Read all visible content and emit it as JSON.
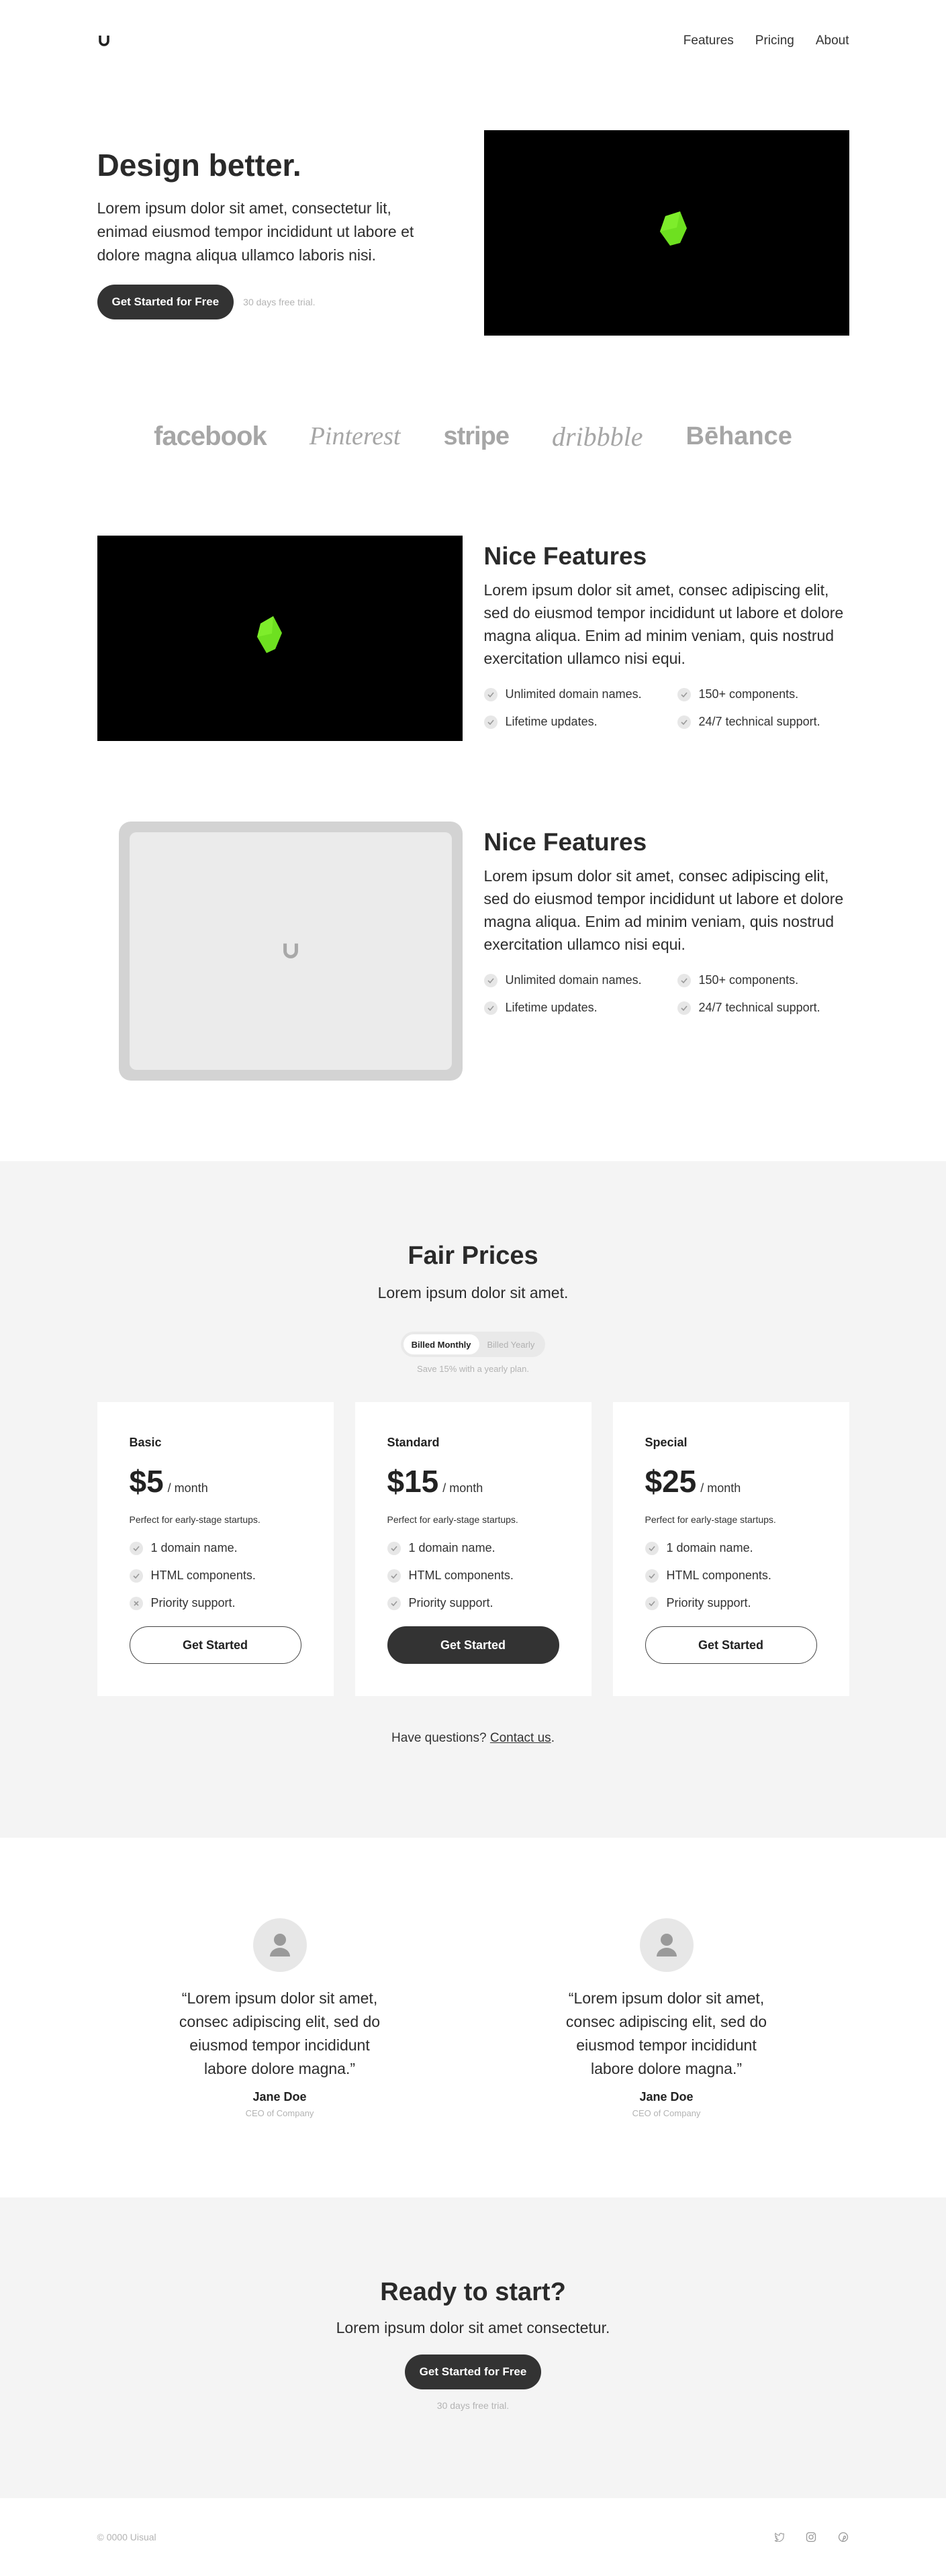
{
  "nav": {
    "links": [
      "Features",
      "Pricing",
      "About"
    ]
  },
  "hero": {
    "title": "Design better.",
    "text": "Lorem ipsum dolor sit amet, consectetur lit, enimad eiusmod tempor incididunt ut labore et dolore magna aliqua ullamco laboris nisi.",
    "cta": "Get Started for Free",
    "note": "30 days free trial."
  },
  "logos": [
    "facebook",
    "Pinterest",
    "stripe",
    "dribbble",
    "Bēhance"
  ],
  "features": [
    {
      "title": "Nice Features",
      "text": "Lorem ipsum dolor sit amet, consec adipiscing elit, sed do eiusmod tempor incididunt ut labore et dolore magna aliqua. Enim ad minim veniam, quis nostrud exercitation ullamco nisi equi.",
      "items": [
        "Unlimited domain names.",
        "150+ components.",
        "Lifetime updates.",
        "24/7 technical support."
      ]
    },
    {
      "title": "Nice Features",
      "text": "Lorem ipsum dolor sit amet, consec adipiscing elit, sed do eiusmod tempor incididunt ut labore et dolore magna aliqua. Enim ad minim veniam, quis nostrud exercitation ullamco nisi equi.",
      "items": [
        "Unlimited domain names.",
        "150+ components.",
        "Lifetime updates.",
        "24/7 technical support."
      ]
    }
  ],
  "pricing": {
    "title": "Fair Prices",
    "subtitle": "Lorem ipsum dolor sit amet.",
    "toggle": [
      "Billed Monthly",
      "Billed Yearly"
    ],
    "save_note": "Save 15% with a yearly plan.",
    "plans": [
      {
        "name": "Basic",
        "price": "$5",
        "per": "/ month",
        "desc": "Perfect for early-stage startups.",
        "items": [
          "1 domain name.",
          "HTML components.",
          "Priority support."
        ],
        "button": "Get Started"
      },
      {
        "name": "Standard",
        "price": "$15",
        "per": "/ month",
        "desc": "Perfect for early-stage startups.",
        "items": [
          "1 domain name.",
          "HTML components.",
          "Priority support."
        ],
        "button": "Get Started"
      },
      {
        "name": "Special",
        "price": "$25",
        "per": "/ month",
        "desc": "Perfect for early-stage startups.",
        "items": [
          "1 domain name.",
          "HTML components.",
          "Priority support."
        ],
        "button": "Get Started"
      }
    ],
    "questions": "Have questions?",
    "contact": "Contact us",
    "period": "."
  },
  "testimonials": [
    {
      "quote": "“Lorem ipsum dolor sit amet, consec adipiscing elit, sed do eiusmod tempor incididunt labore dolore magna.”",
      "name": "Jane Doe",
      "role": "CEO of Company"
    },
    {
      "quote": "“Lorem ipsum dolor sit amet, consec adipiscing elit, sed do eiusmod tempor incididunt labore dolore magna.”",
      "name": "Jane Doe",
      "role": "CEO of Company"
    }
  ],
  "ready": {
    "title": "Ready to start?",
    "subtitle": "Lorem ipsum dolor sit amet consectetur.",
    "cta": "Get Started for Free",
    "note": "30 days free trial."
  },
  "footer": {
    "copyright": "© 0000 Uisual",
    "socials": [
      "twitter-icon",
      "instagram-icon",
      "pinterest-icon"
    ]
  },
  "colors": {
    "accent_shape": "#6ee020",
    "dark": "#333333",
    "light_bg": "#f4f4f4"
  }
}
